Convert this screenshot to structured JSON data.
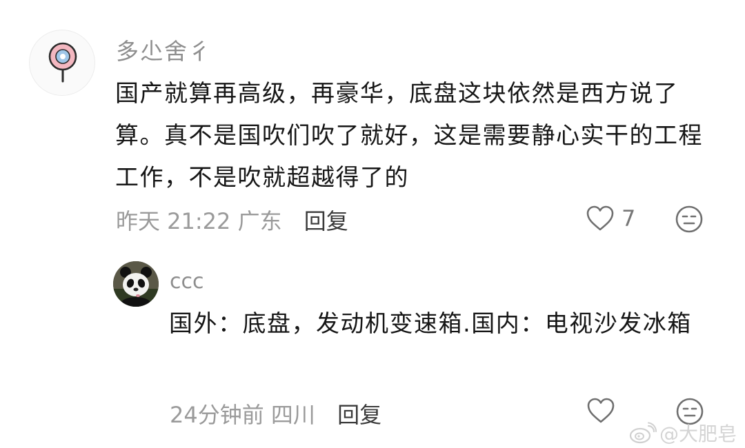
{
  "comment": {
    "username": "多尐舍彳",
    "text": "国产就算再高级，再豪华，底盘这块依然是西方说了算。真不是国吹们吹了就好，这是需要静心实干的工程工作，不是吹就超越得了的",
    "time": "昨天 21:22",
    "location": "广东",
    "reply_label": "回复",
    "like_count": "7",
    "icons": {
      "like": "heart-icon",
      "dislike": "meh-face-icon"
    }
  },
  "reply": {
    "username": "ccc",
    "text": "国外：底盘，发动机变速箱.国内：电视沙发冰箱",
    "time": "24分钟前",
    "location": "四川",
    "reply_label": "回复",
    "icons": {
      "like": "heart-icon",
      "dislike": "meh-face-icon"
    }
  },
  "watermark": {
    "text": "@大肥皂"
  }
}
